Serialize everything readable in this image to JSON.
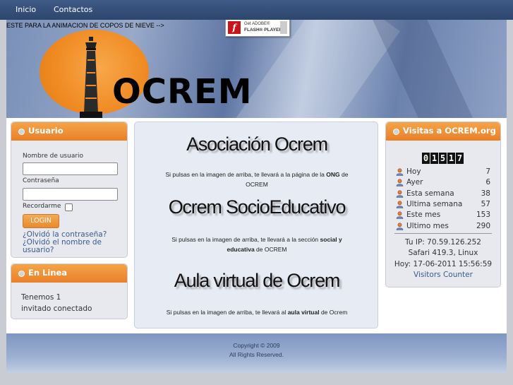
{
  "nav": {
    "items": [
      {
        "label": "Inicio"
      },
      {
        "label": "Contactos"
      }
    ]
  },
  "header": {
    "animation_comment": "ESTE PARA LA ANIMACION DE COPOS DE NIEVE -->",
    "flash_badge": {
      "line1": "Get ADOBE®",
      "line2": "FLASH® PLAYER"
    },
    "logo_text": "OCREM",
    "logo_colors": {
      "sun": "#f08a22",
      "text": "#000000"
    }
  },
  "login": {
    "title": "Usuario",
    "username_label": "Nombre de usuario",
    "username_value": "",
    "password_label": "Contraseña",
    "password_value": "",
    "remember_label": "Recordarme",
    "remember_checked": false,
    "login_button": "LOGIN",
    "forgot_password": "¿Olvidó la contraseña?",
    "forgot_username_line1": "¿Olvidó el nombre de",
    "forgot_username_line2": "usuario?"
  },
  "online": {
    "title": "En Linea",
    "line1": "Tenemos 1",
    "line2": "invitado conectado"
  },
  "main": {
    "sections": [
      {
        "heading": "Asociación Ocrem",
        "text_before": "Si pulsas en la imagen de arriba, te llevará a la página de la ",
        "bold": "ONG",
        "text_after_line1": " de",
        "line2": "OCREM"
      },
      {
        "heading": "Ocrem SocioEducativo",
        "text_before": "Si pulsas en la imagen de arriba, te llevará a la sección ",
        "bold": "social y",
        "bold2": "educativa",
        "text_after": " de OCREM"
      },
      {
        "heading": "Aula virtual de Ocrem",
        "text_before": "Si pulsas en la imagen de arriba, te llevará al ",
        "bold": "aula virtual",
        "text_after": " de Ocrem"
      }
    ]
  },
  "visits": {
    "title": "Visitas a OCREM.org",
    "counter_digits": [
      "0",
      "1",
      "5",
      "1",
      "7"
    ],
    "stats": [
      {
        "label": "Hoy",
        "value": "7",
        "icon": "user-icon"
      },
      {
        "label": "Ayer",
        "value": "6",
        "icon": "user-icon"
      },
      {
        "label": "Esta semana",
        "value": "38",
        "icon": "user-icon"
      },
      {
        "label": "Ultima semana",
        "value": "57",
        "icon": "user-icon"
      },
      {
        "label": "Este mes",
        "value": "153",
        "icon": "user-icon"
      },
      {
        "label": "Ultimo mes",
        "value": "290",
        "icon": "user-icon"
      }
    ],
    "ip": "Tu IP: 70.59.126.252",
    "browser": "Safari 419.3, Linux",
    "date": "Hoy: 17-06-2011 15:56:59",
    "counter_link": "Visitors Counter"
  },
  "footer": {
    "copyright": "Copyright © 2009",
    "rights": "All Rights Reserved."
  },
  "colors": {
    "accent_orange": "#e9802a",
    "nav_blue": "#2d466d",
    "link_blue": "#3a5a8c"
  }
}
